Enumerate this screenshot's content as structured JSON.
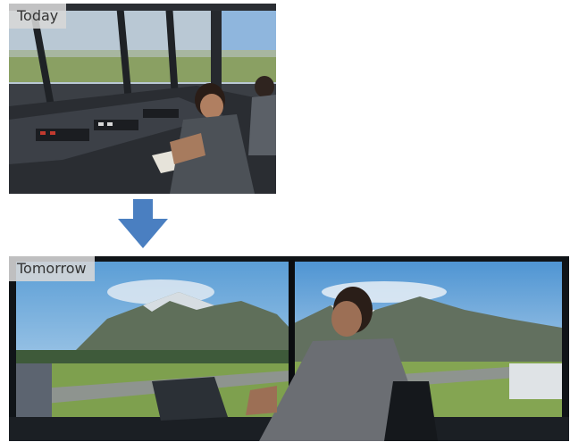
{
  "panels": {
    "today": {
      "label": "Today"
    },
    "tomorrow": {
      "label": "Tomorrow"
    }
  },
  "icons": {
    "transition": "down-arrow-icon"
  },
  "colors": {
    "arrow": "#4a7fc1",
    "label_bg": "#d7d7d7",
    "label_text": "#333333",
    "tower_frame": "#1a1c1f",
    "sky": "#7fb8e4",
    "grass": "#6f9a42"
  }
}
